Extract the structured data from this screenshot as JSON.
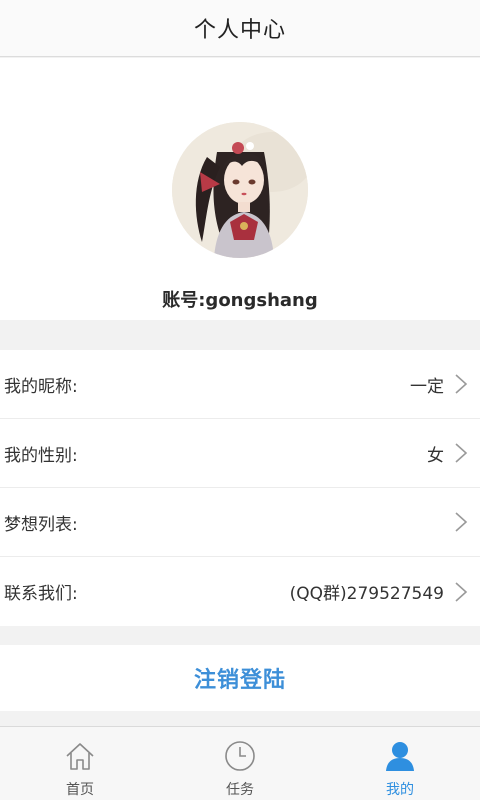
{
  "header": {
    "title": "个人中心"
  },
  "profile": {
    "avatar_icon": "user-avatar-image",
    "account_label": "账号:gongshang"
  },
  "settings": [
    {
      "label": "我的昵称:",
      "value": "一定"
    },
    {
      "label": "我的性别:",
      "value": "女"
    },
    {
      "label": "梦想列表:",
      "value": ""
    },
    {
      "label": "联系我们:",
      "value": "(QQ群)279527549"
    }
  ],
  "logout": {
    "label": "注销登陆"
  },
  "tabbar": {
    "tabs": [
      {
        "label": "首页",
        "icon": "home-icon",
        "active": false
      },
      {
        "label": "任务",
        "icon": "clock-icon",
        "active": false
      },
      {
        "label": "我的",
        "icon": "person-icon",
        "active": true
      }
    ]
  },
  "colors": {
    "accent": "#2e8fe0",
    "logout_text": "#3d8fd8",
    "background": "#f2f2f2"
  }
}
